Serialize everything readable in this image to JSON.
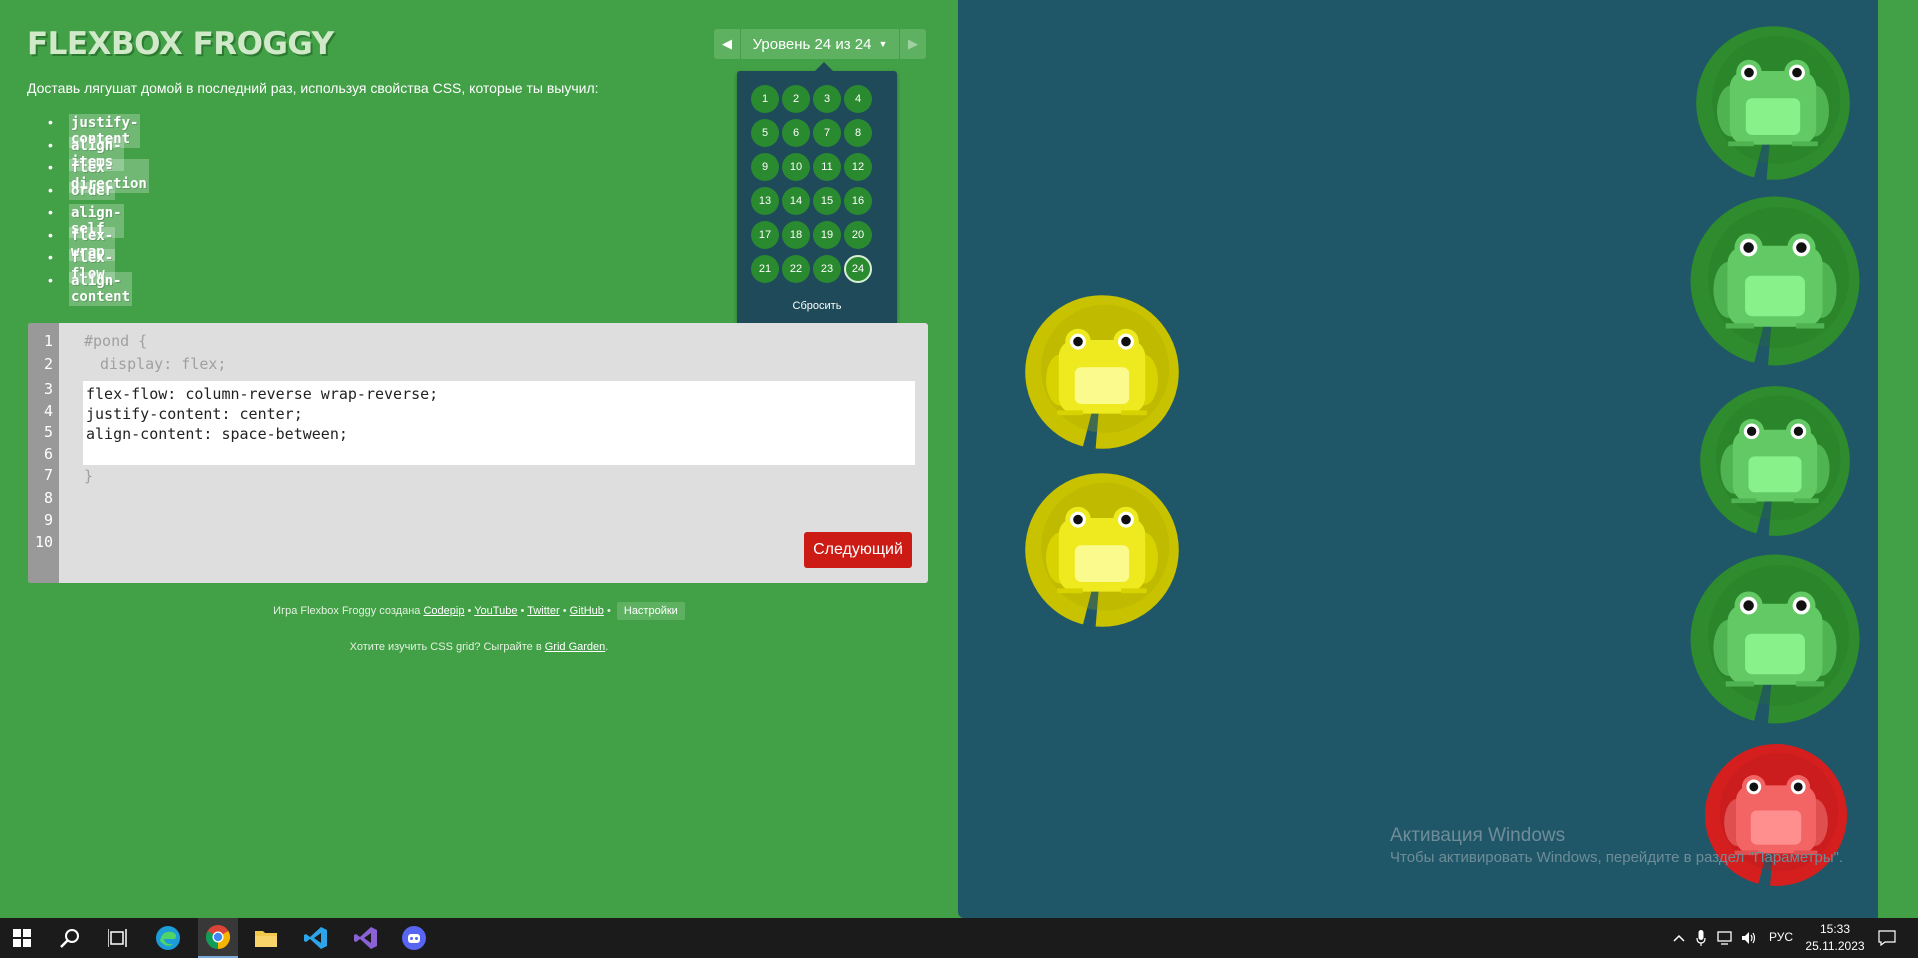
{
  "logo": "FLEXBOX FROGGY",
  "level_nav": {
    "indicator": "Уровень 24 из 24",
    "prev_icon": "triangle-left-icon",
    "next_icon": "triangle-right-icon"
  },
  "levels_popup": {
    "levels": [
      "1",
      "2",
      "3",
      "4",
      "5",
      "6",
      "7",
      "8",
      "9",
      "10",
      "11",
      "12",
      "13",
      "14",
      "15",
      "16",
      "17",
      "18",
      "19",
      "20",
      "21",
      "22",
      "23",
      "24"
    ],
    "current": "24",
    "reset": "Сбросить"
  },
  "instructions": "Доставь лягушат домой в последний раз, используя свойства CSS, которые ты выучил:",
  "properties": [
    "justify-content",
    "align-items",
    "flex-direction",
    "order",
    "align-self",
    "flex-wrap",
    "flex-flow",
    "align-content"
  ],
  "editor": {
    "line_numbers": [
      "1",
      "2",
      "3",
      "4",
      "5",
      "6",
      "7",
      "8",
      "9",
      "10"
    ],
    "before": [
      "#pond {",
      "display: flex;"
    ],
    "input_lines": [
      "flex-flow: column-reverse wrap-reverse;",
      "justify-content: center;",
      "align-content: space-between;"
    ],
    "after": [
      "}"
    ],
    "next_button": "Следующий"
  },
  "credits": {
    "text": "Игра Flexbox Froggy создана",
    "links": [
      "Codepip",
      "YouTube",
      "Twitter",
      "GitHub"
    ],
    "separator": "•",
    "settings": "Настройки"
  },
  "cssgrid": {
    "text": "Хотите изучить CSS grid? Сыграйте в",
    "link": "Grid Garden",
    "suffix": "."
  },
  "pond": {
    "lilypads": [
      {
        "color": "yellow"
      },
      {
        "color": "yellow"
      },
      {
        "color": "green"
      },
      {
        "color": "green"
      },
      {
        "color": "green"
      },
      {
        "color": "green"
      },
      {
        "color": "red"
      }
    ],
    "colors": {
      "pond": "#1f5768",
      "green_pad": "#2e8b2e",
      "yellow_pad": "#c8c200",
      "red_pad": "#d51f1f"
    }
  },
  "watermark": {
    "title": "Активация Windows",
    "text": "Чтобы активировать Windows, перейдите в раздел \"Параметры\"."
  },
  "taskbar": {
    "apps": [
      "windows-start-icon",
      "search-icon",
      "task-view-icon",
      "edge-icon",
      "chrome-icon",
      "file-explorer-icon",
      "vscode-icon",
      "visual-studio-icon",
      "discord-icon"
    ],
    "language": "РУС",
    "time": "15:33",
    "date": "25.11.2023"
  }
}
